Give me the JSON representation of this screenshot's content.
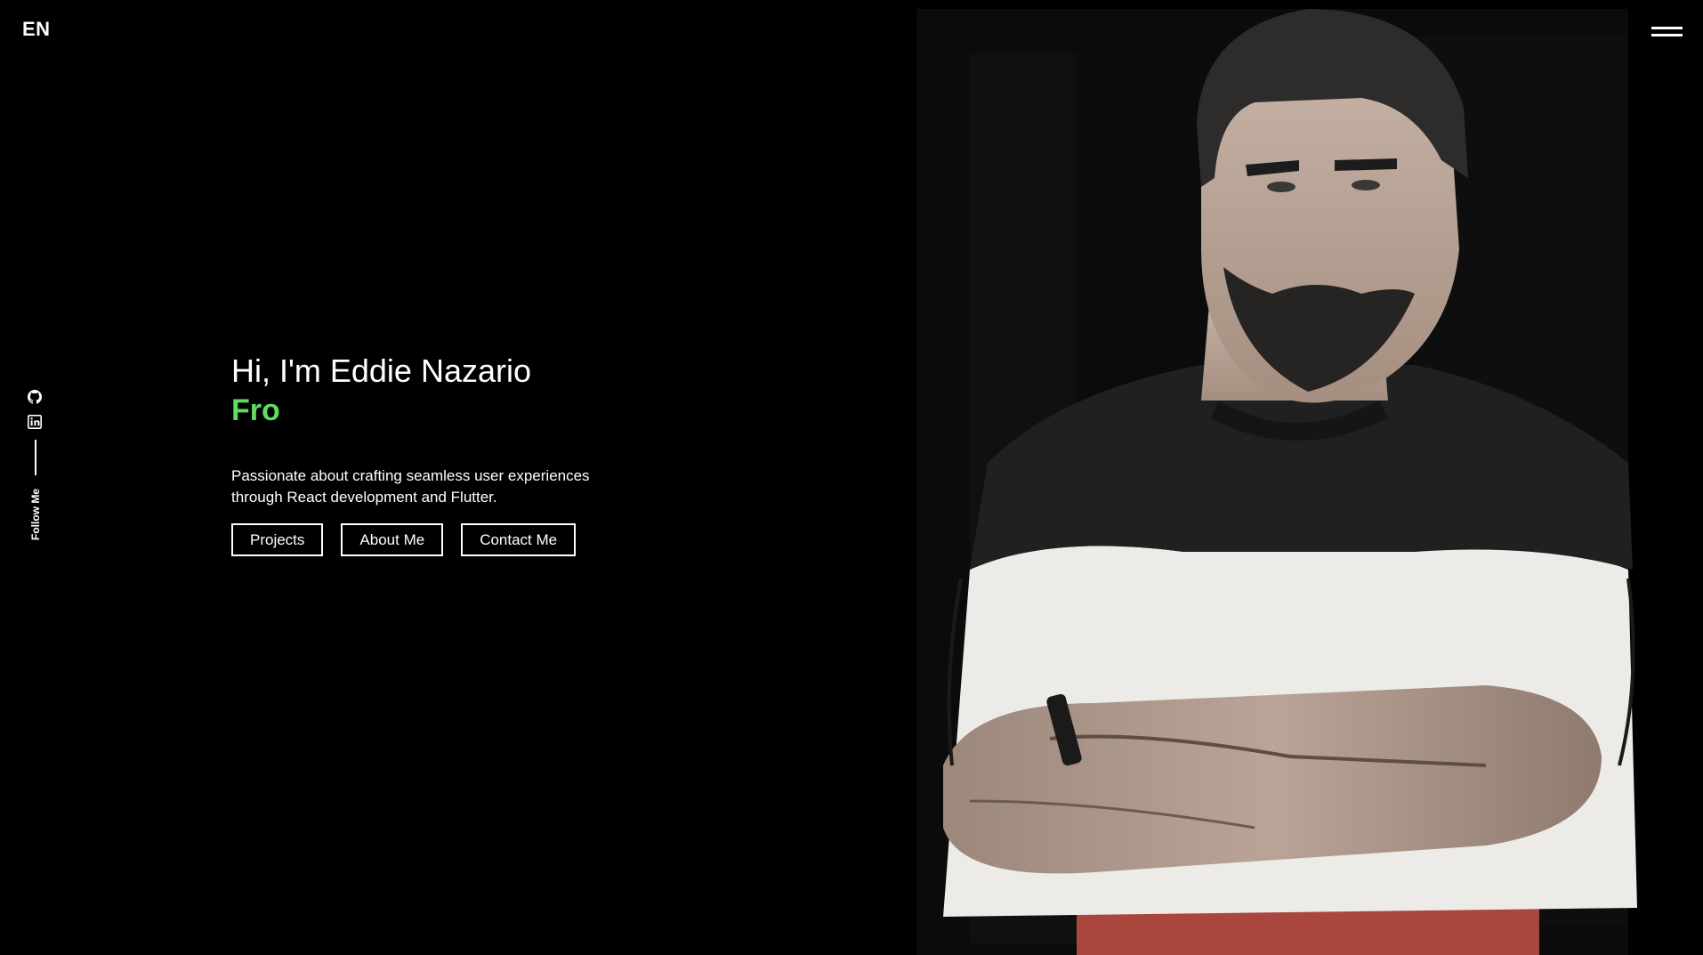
{
  "header": {
    "language": "EN"
  },
  "social": {
    "follow_label": "Follow Me"
  },
  "hero": {
    "greeting": "Hi, I'm Eddie Nazario",
    "role_typed": "Fro",
    "bio": "Passionate about crafting seamless user experiences through React development and Flutter.",
    "buttons": {
      "projects": "Projects",
      "about": "About Me",
      "contact": "Contact Me"
    }
  },
  "colors": {
    "background": "#000000",
    "text": "#ffffff",
    "accent": "#5fdd62"
  },
  "icons": {
    "theme": "contrast-icon",
    "menu": "hamburger-menu-icon",
    "github": "github-icon",
    "linkedin": "linkedin-icon"
  }
}
